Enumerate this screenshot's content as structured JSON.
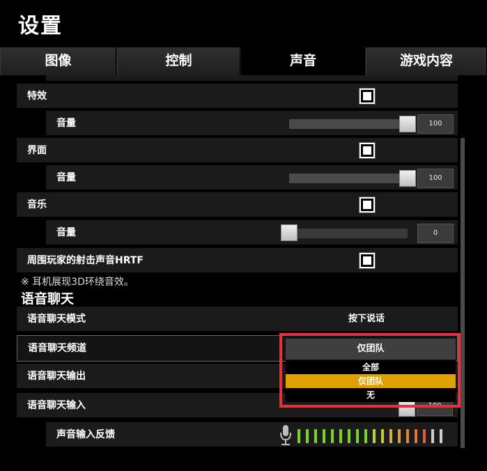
{
  "page_title": "设置",
  "tabs": [
    {
      "label": "图像",
      "active": false
    },
    {
      "label": "控制",
      "active": false
    },
    {
      "label": "声音",
      "active": true
    },
    {
      "label": "游戏内容",
      "active": false
    }
  ],
  "settings": {
    "effects": {
      "label": "特效",
      "checked": true,
      "volume_label": "音量",
      "volume_value": "100",
      "volume_fraction": 1.0
    },
    "interface": {
      "label": "界面",
      "checked": true,
      "volume_label": "音量",
      "volume_value": "100",
      "volume_fraction": 1.0
    },
    "music": {
      "label": "音乐",
      "checked": true,
      "volume_label": "音量",
      "volume_value": "0",
      "volume_fraction": 0.0
    },
    "hrtf": {
      "label": "周围玩家的射击声音HRTF",
      "checked": true
    }
  },
  "hrtf_note": "※ 耳机展现3D环绕音效。",
  "voice_chat": {
    "section_title": "语音聊天",
    "mode_label": "语音聊天模式",
    "mode_value": "按下说话",
    "channel_label": "语音聊天频道",
    "output_label": "语音聊天输出",
    "input_label": "语音聊天输入",
    "input_value_partial": "100",
    "feedback_label": "声音输入反馈"
  },
  "channel_dropdown": {
    "selected": "仅团队",
    "options": [
      {
        "label": "全部",
        "selected": false
      },
      {
        "label": "仅团队",
        "selected": true
      },
      {
        "label": "无",
        "selected": false
      }
    ],
    "highlight_color": "#e0a000",
    "annotation_color": "#e5303d"
  },
  "meter_colors": [
    "#7ed321",
    "#7ed321",
    "#7ed321",
    "#7ed321",
    "#7ed321",
    "#7ed321",
    "#7ed321",
    "#7ed321",
    "#7ed321",
    "#b8d429",
    "#c9cc2c",
    "#d4b32e",
    "#d9a030",
    "#e08a30",
    "#e27530",
    "#e35d2c",
    "#cfcfcf",
    "#cfcfcf"
  ]
}
